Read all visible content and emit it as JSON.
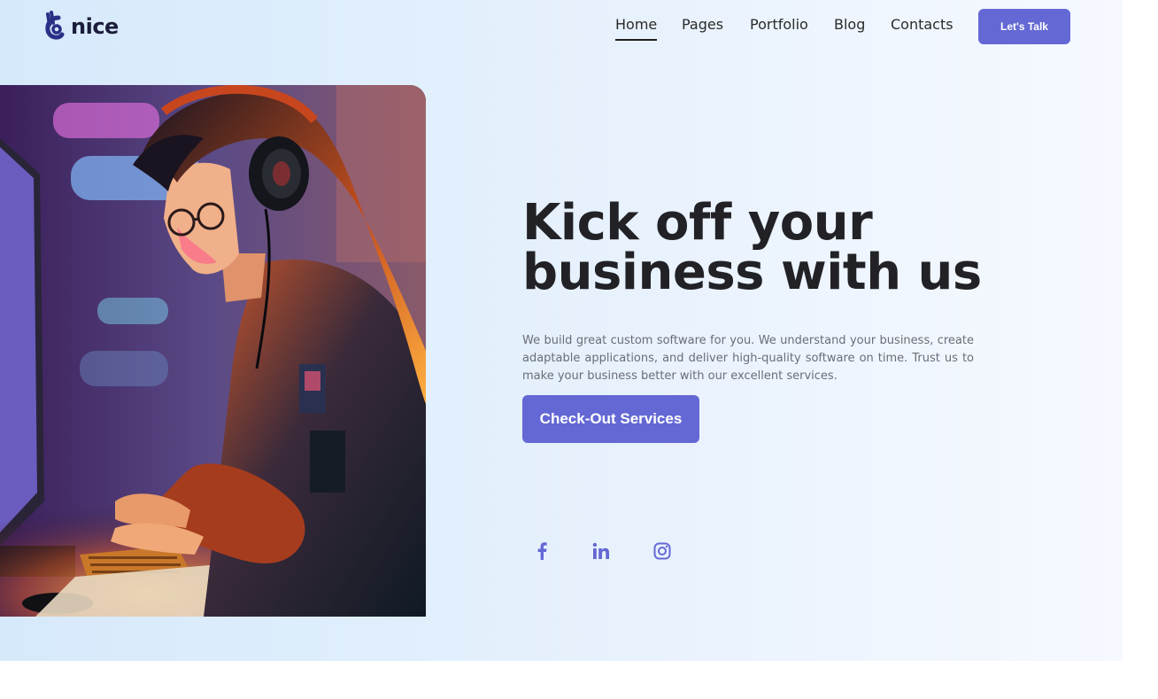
{
  "brand": {
    "name": "nice",
    "icon": "hand-ok-logo-icon"
  },
  "nav": {
    "items": [
      {
        "label": "Home",
        "active": true
      },
      {
        "label": "Pages",
        "active": false
      },
      {
        "label": "Portfolio",
        "active": false
      },
      {
        "label": "Blog",
        "active": false
      },
      {
        "label": "Contacts",
        "active": false
      }
    ],
    "cta_label": "Let's Talk"
  },
  "hero": {
    "headline_line1": "Kick off your",
    "headline_line2": "business with us",
    "description": "We build great custom software for you. We understand your business, create adaptable applications, and deliver high-quality software on time. Trust us to make your business better with our excellent services.",
    "cta_label": "Check-Out Services",
    "image": "woman-with-headphones-coding-illustration"
  },
  "social": [
    {
      "icon": "facebook-icon"
    },
    {
      "icon": "linkedin-icon"
    },
    {
      "icon": "instagram-icon"
    }
  ],
  "colors": {
    "accent": "#6468d4",
    "heading": "#222226",
    "body_text": "#6a6d76",
    "nav_text": "#2a2a2a",
    "logo_dark": "#1b1d3a"
  }
}
